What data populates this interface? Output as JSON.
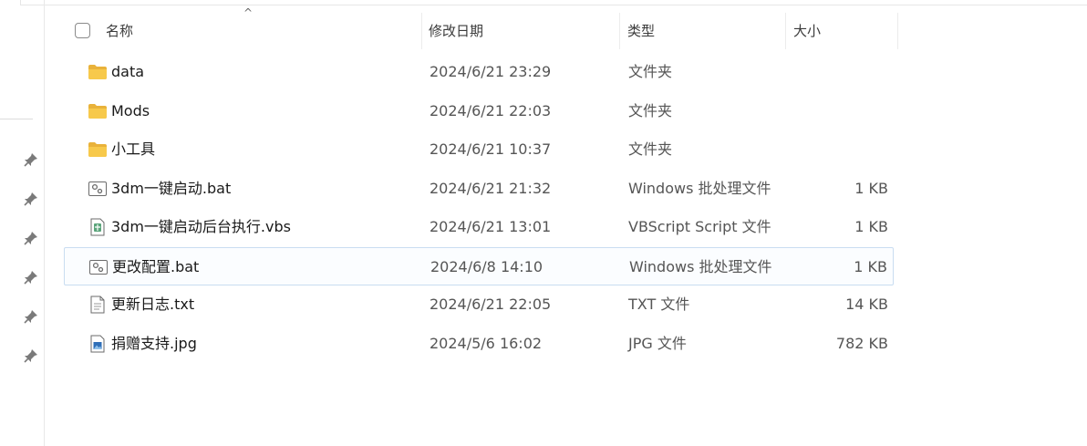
{
  "columns": {
    "name": "名称",
    "date": "修改日期",
    "type": "类型",
    "size": "大小"
  },
  "files": [
    {
      "name": "data",
      "date": "2024/6/21 23:29",
      "type": "文件夹",
      "size": "",
      "icon": "folder-icon"
    },
    {
      "name": "Mods",
      "date": "2024/6/21 22:03",
      "type": "文件夹",
      "size": "",
      "icon": "folder-icon"
    },
    {
      "name": "小工具",
      "date": "2024/6/21 10:37",
      "type": "文件夹",
      "size": "",
      "icon": "folder-icon"
    },
    {
      "name": "3dm一键启动.bat",
      "date": "2024/6/21 21:32",
      "type": "Windows 批处理文件",
      "size": "1 KB",
      "icon": "batch-file-icon"
    },
    {
      "name": "3dm一键启动后台执行.vbs",
      "date": "2024/6/21 13:01",
      "type": "VBScript Script 文件",
      "size": "1 KB",
      "icon": "vbs-script-icon"
    },
    {
      "name": "更改配置.bat",
      "date": "2024/6/8 14:10",
      "type": "Windows 批处理文件",
      "size": "1 KB",
      "icon": "batch-file-icon"
    },
    {
      "name": "更新日志.txt",
      "date": "2024/6/21 22:05",
      "type": "TXT 文件",
      "size": "14 KB",
      "icon": "text-file-icon"
    },
    {
      "name": "捐赠支持.jpg",
      "date": "2024/5/6 16:02",
      "type": "JPG 文件",
      "size": "782 KB",
      "icon": "image-file-icon"
    }
  ],
  "selected_row": "更改配置.bat",
  "colors": {
    "folder": "#f7c94b",
    "selection_border": "#c9ddf1",
    "header_text": "#3b3b3b"
  }
}
